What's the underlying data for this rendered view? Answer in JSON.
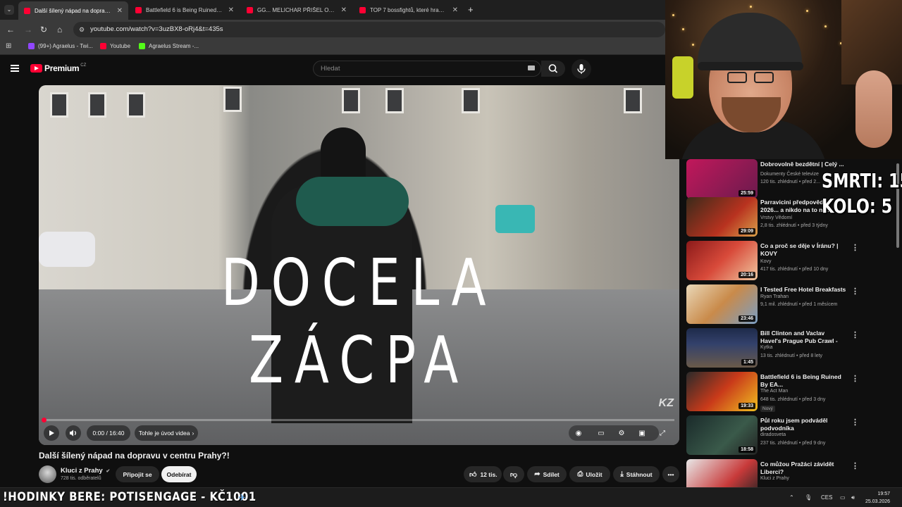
{
  "browser": {
    "tabs": [
      {
        "title": "Další šílený nápad na dopravu v",
        "active": true
      },
      {
        "title": "Battlefield 6 is Being Ruined By",
        "active": false
      },
      {
        "title": "GG... MELICHAR PŘIŠEL O DALŠ",
        "active": false
      },
      {
        "title": "TOP 7 bossfightů, které hraničí",
        "active": false
      }
    ],
    "new_tab": "+",
    "url": "youtube.com/watch?v=3uzBX8-oRj4&t=435s",
    "bookmarks": [
      {
        "label": "(99+) Agraelus - Twi...",
        "color": "#9146ff"
      },
      {
        "label": "Youtube",
        "color": "#ff0033"
      },
      {
        "label": "Agraelus Stream -...",
        "color": "#53fc18"
      }
    ]
  },
  "youtube": {
    "logo_text": "Premium",
    "logo_region": "CZ",
    "search_placeholder": "Hledat",
    "video": {
      "overlay_text": "DOCELA ZÁCPA",
      "watermark": "KZ",
      "time": "0:00 / 16:40",
      "chapter": "Tohle je úvod videa",
      "progress_fraction": 0.005
    },
    "title": "Další šílený nápad na dopravu v centru Prahy?!",
    "channel": {
      "name": "Kluci z Prahy",
      "subs": "728 tis. odběratelů"
    },
    "buttons": {
      "join": "Připojit se",
      "subscribe": "Odebírat",
      "likes": "12 tis.",
      "share": "Sdílet",
      "save": "Uložit",
      "download": "Stáhnout"
    },
    "recommended": [
      {
        "title": "Dobrovolně bezdětní | Celý ...",
        "channel": "Dokumenty České televize",
        "meta": "120 tis. zhlédnutí • před 2...",
        "duration": "25:59"
      },
      {
        "title": "Parravicini předpovědě 2026... a nikdo na to ne...",
        "channel": "Vrstvy Vědomí",
        "meta": "2,8 tis. zhlédnutí • před 3 týdny",
        "duration": "29:09"
      },
      {
        "title": "Co a proč se děje v Íránu? | KOVY",
        "channel": "Kovy",
        "meta": "417 tis. zhlédnutí • před 10 dny",
        "duration": "20:16"
      },
      {
        "title": "I Tested Free Hotel Breakfasts",
        "channel": "Ryan Trahan",
        "meta": "9,1 mil. zhlédnutí • před 1 měsícem",
        "duration": "23:46"
      },
      {
        "title": "Bill Clinton and Vaclav Havel's Prague Pub Crawl - Czech Bee...",
        "channel": "Kytka",
        "meta": "13 tis. zhlédnutí • před 8 lety",
        "duration": "1:45"
      },
      {
        "title": "Battlefield 6 is Being Ruined By EA...",
        "channel": "The Act Man",
        "meta": "648 tis. zhlédnutí • před 3 dny",
        "duration": "19:33",
        "badge": "Nový"
      },
      {
        "title": "Půl roku jsem podváděl podvodníka",
        "channel": "diradosveta",
        "meta": "237 tis. zhlédnutí • před 9 dny",
        "duration": "18:58"
      },
      {
        "title": "Co můžou Pražáci závidět Liberci?",
        "channel": "Kluci z Prahy",
        "meta": "",
        "duration": ""
      }
    ]
  },
  "stream_overlay": {
    "deaths": "SMRTI: 15",
    "round": "KOLO: 5",
    "ticker": "!HODINKY BERE: POTISENGAGE - KČ1001"
  },
  "taskbar": {
    "lang": "CES",
    "time": "19:57",
    "date": "25.03.2026"
  }
}
